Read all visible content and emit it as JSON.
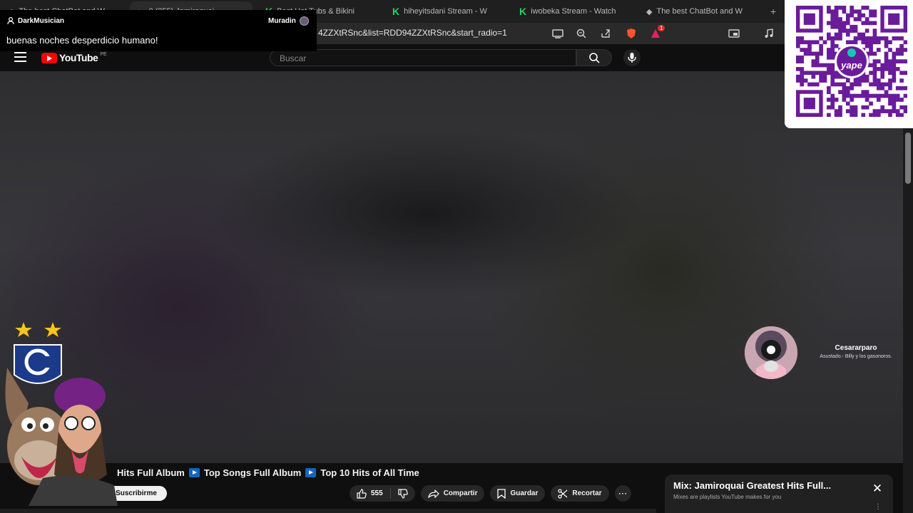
{
  "browser": {
    "tabs": [
      {
        "label": "The best ChatBot and W",
        "active": false,
        "icon": "diamond-icon"
      },
      {
        "label": "0 (255) Jamiroquai",
        "active": true,
        "icon": "youtube-icon"
      },
      {
        "label": "Best Hot Tubs & Bikini",
        "active": false,
        "icon": "kick-icon"
      },
      {
        "label": "hiheyitsdani Stream - W",
        "active": false,
        "icon": "kick-icon"
      },
      {
        "label": "iwobeka Stream - Watch",
        "active": false,
        "icon": "kick-icon"
      },
      {
        "label": "The best ChatBot and W",
        "active": false,
        "icon": "diamond-icon"
      }
    ],
    "new_tab": "+",
    "url": "4ZZXtRSnc&list=RDD94ZZXtRSnc&start_radio=1",
    "brave_badge": "1"
  },
  "youtube": {
    "logo_text": "YouTube",
    "country_code": "PE",
    "search_placeholder": "Buscar"
  },
  "chat": {
    "username": "DarkMusician",
    "right_user": "Muradin",
    "message": "buenas noches desperdicio humano!"
  },
  "video": {
    "title_parts": [
      "Hits Full Album",
      "Top Songs Full Album",
      "Top 10 Hits of All Time"
    ],
    "subscribe_label": "Suscribirme",
    "likes": "555",
    "share_label": "Compartir",
    "save_label": "Guardar",
    "clip_label": "Recortar",
    "more_label": "⋯"
  },
  "mix": {
    "title": "Mix: Jamiroquai Greatest Hits Full...",
    "subtitle": "Mixes are playlists YouTube makes for you",
    "close": "✕"
  },
  "notification": {
    "name": "Cesararparo",
    "song": "Asustado.- Billy y los gasonoros."
  },
  "qr": {
    "brand_text": "yape"
  },
  "colors": {
    "youtube_red": "#ff0000",
    "kick_green": "#25d366",
    "qr_purple": "#6a1b9a",
    "accent_purple": "#742284"
  }
}
